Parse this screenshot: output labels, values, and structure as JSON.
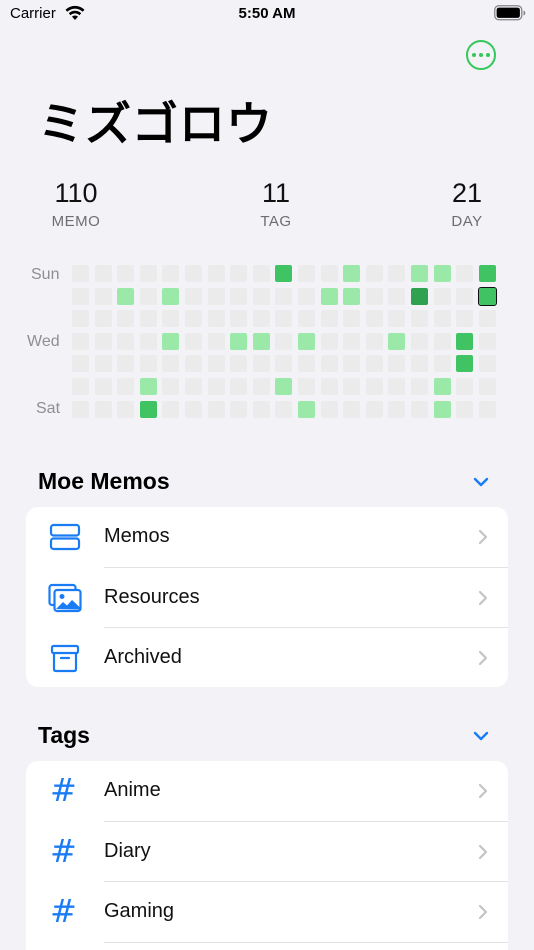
{
  "status_bar": {
    "carrier": "Carrier",
    "time": "5:50 AM"
  },
  "header": {
    "title": "ミズゴロウ"
  },
  "stats": [
    {
      "value": "110",
      "label": "MEMO"
    },
    {
      "value": "11",
      "label": "TAG"
    },
    {
      "value": "21",
      "label": "DAY"
    }
  ],
  "heatmap": {
    "day_labels": {
      "sun": "Sun",
      "wed": "Wed",
      "sat": "Sat"
    },
    "colors": {
      "empty": "#ebebeb",
      "level1": "#9be9a8",
      "level2": "#40c463",
      "level3": "#30a14e"
    },
    "grid": [
      [
        0,
        0,
        0,
        0,
        0,
        0,
        0,
        0,
        0,
        2,
        0,
        0,
        1,
        0,
        0,
        1,
        1,
        0,
        2
      ],
      [
        0,
        0,
        1,
        0,
        1,
        0,
        0,
        0,
        0,
        0,
        0,
        1,
        1,
        0,
        0,
        3,
        0,
        0,
        2
      ],
      [
        0,
        0,
        0,
        0,
        0,
        0,
        0,
        0,
        0,
        0,
        0,
        0,
        0,
        0,
        0,
        0,
        0,
        0,
        0
      ],
      [
        0,
        0,
        0,
        0,
        1,
        0,
        0,
        1,
        1,
        0,
        1,
        0,
        0,
        0,
        1,
        0,
        0,
        2,
        0
      ],
      [
        0,
        0,
        0,
        0,
        0,
        0,
        0,
        0,
        0,
        0,
        0,
        0,
        0,
        0,
        0,
        0,
        0,
        2,
        0
      ],
      [
        0,
        0,
        0,
        1,
        0,
        0,
        0,
        0,
        0,
        1,
        0,
        0,
        0,
        0,
        0,
        0,
        1,
        0,
        0
      ],
      [
        0,
        0,
        0,
        2,
        0,
        0,
        0,
        0,
        0,
        0,
        1,
        0,
        0,
        0,
        0,
        0,
        1,
        0,
        0
      ]
    ],
    "today": {
      "row": 1,
      "col": 18
    }
  },
  "sections": {
    "moe_memos": {
      "title": "Moe Memos",
      "items": [
        {
          "label": "Memos",
          "icon": "rectangles-stack-icon"
        },
        {
          "label": "Resources",
          "icon": "photos-icon"
        },
        {
          "label": "Archived",
          "icon": "archive-box-icon"
        }
      ]
    },
    "tags": {
      "title": "Tags",
      "items": [
        {
          "label": "Anime",
          "icon": "hashtag-icon"
        },
        {
          "label": "Diary",
          "icon": "hashtag-icon"
        },
        {
          "label": "Gaming",
          "icon": "hashtag-icon"
        }
      ]
    }
  },
  "accent_color": "#1a7cf5",
  "more_button_color": "#34c759"
}
